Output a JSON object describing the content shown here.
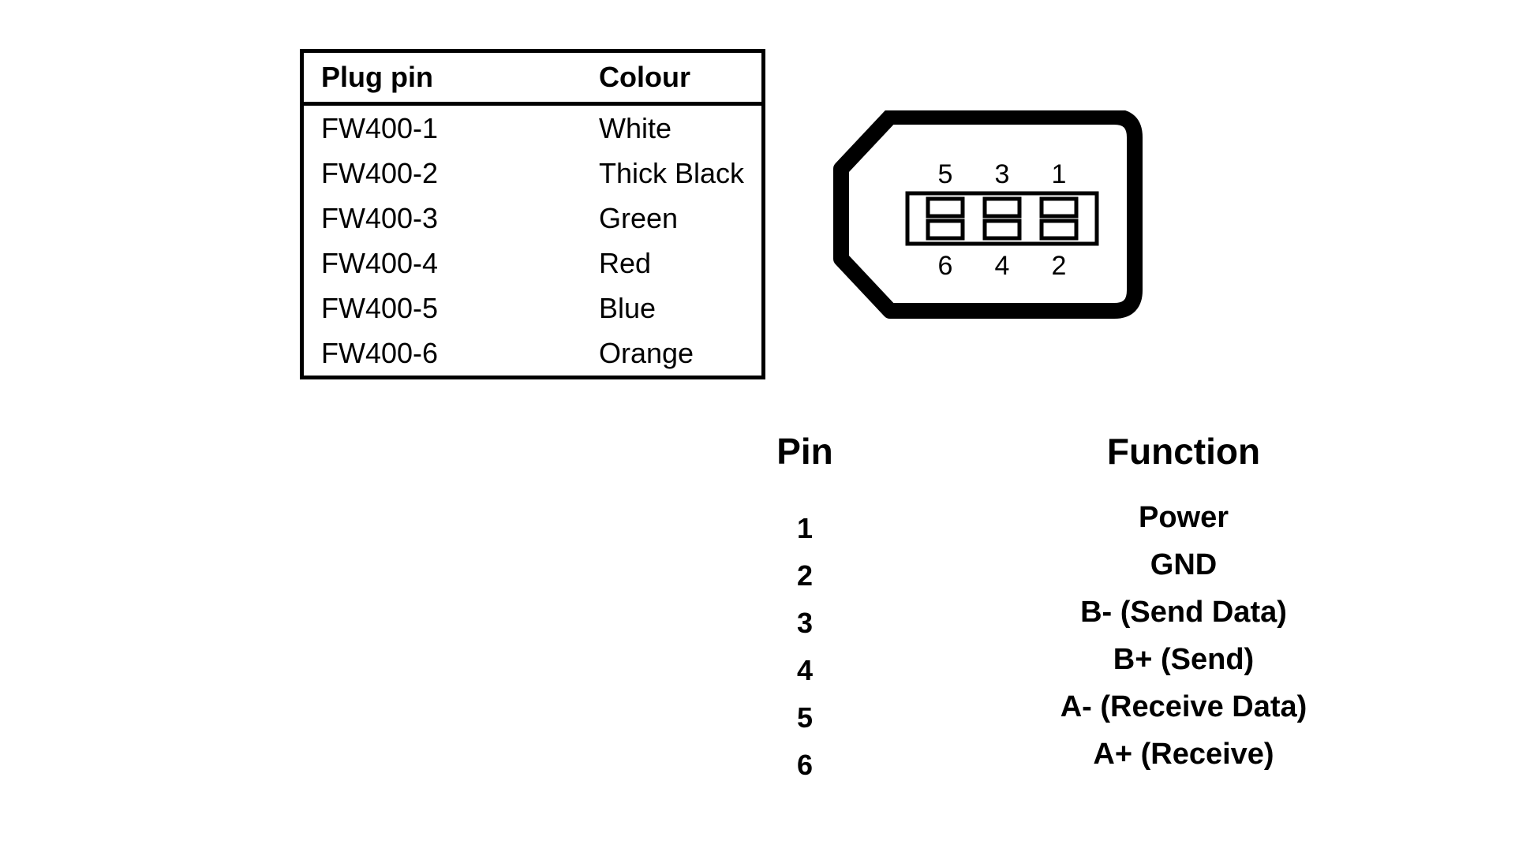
{
  "plug_table": {
    "headers": [
      "Plug pin",
      "Colour"
    ],
    "rows": [
      {
        "plug_pin": "FW400-1",
        "colour": "White"
      },
      {
        "plug_pin": "FW400-2",
        "colour": "Thick Black"
      },
      {
        "plug_pin": "FW400-3",
        "colour": "Green"
      },
      {
        "plug_pin": "FW400-4",
        "colour": "Red"
      },
      {
        "plug_pin": "FW400-5",
        "colour": "Blue"
      },
      {
        "plug_pin": "FW400-6",
        "colour": "Orange"
      }
    ]
  },
  "connector": {
    "top_pin_labels": [
      "5",
      "3",
      "1"
    ],
    "bottom_pin_labels": [
      "6",
      "4",
      "2"
    ],
    "outline_color": "#000000"
  },
  "pin_function": {
    "headers": {
      "pin": "Pin",
      "function": "Function"
    },
    "rows": [
      {
        "pin": "1",
        "function": "Power"
      },
      {
        "pin": "2",
        "function": "GND"
      },
      {
        "pin": "3",
        "function": "B- (Send Data)"
      },
      {
        "pin": "4",
        "function": "B+ (Send)"
      },
      {
        "pin": "5",
        "function": "A- (Receive Data)"
      },
      {
        "pin": "6",
        "function": "A+ (Receive)"
      }
    ]
  }
}
